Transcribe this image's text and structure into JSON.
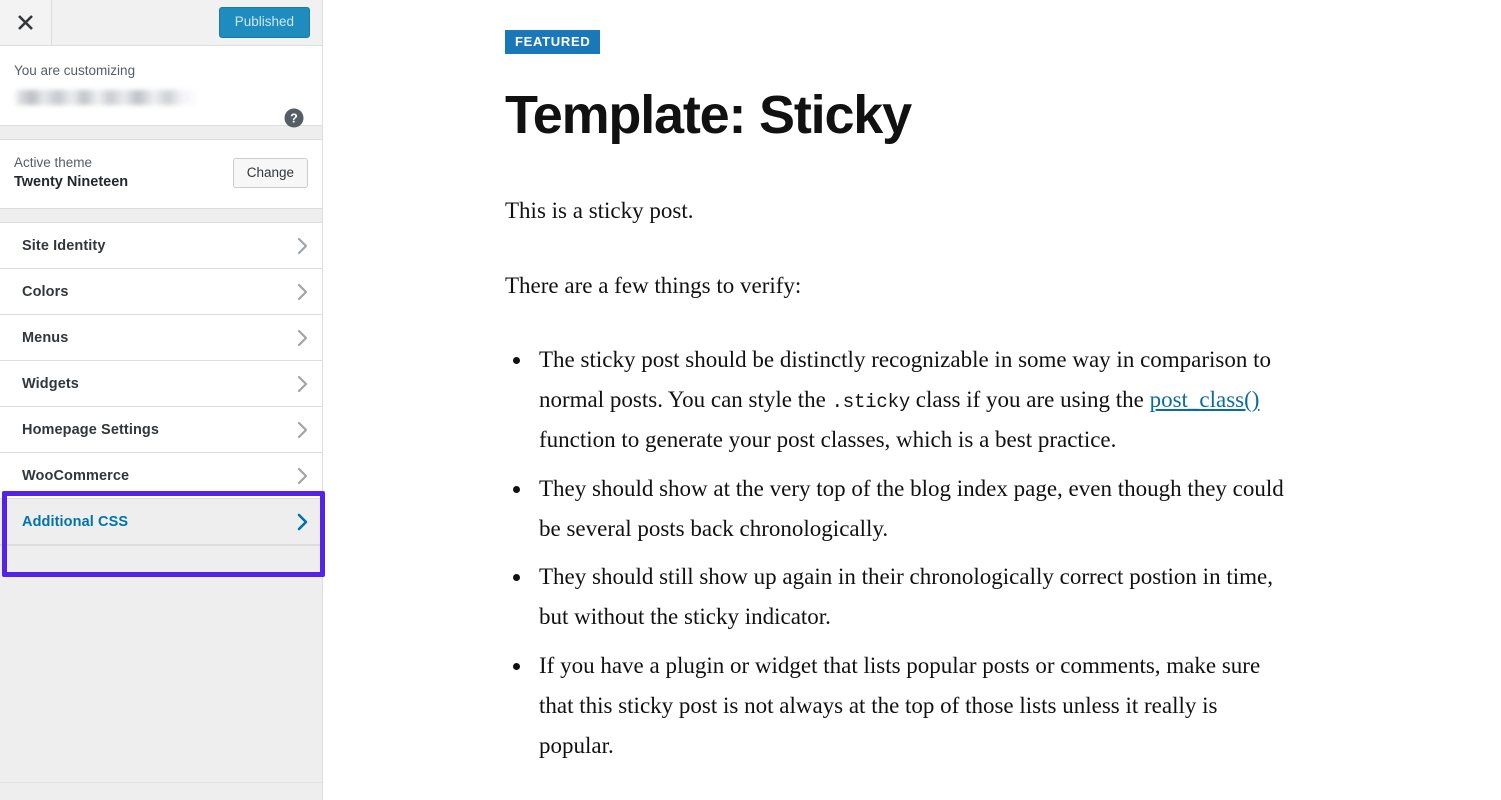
{
  "header": {
    "close_icon": "close-icon",
    "publish_label": "Published"
  },
  "customizing_panel": {
    "label": "You are customizing",
    "site_name": "",
    "help_icon": "help-circle-icon"
  },
  "active_theme": {
    "eyebrow": "Active theme",
    "name": "Twenty Nineteen",
    "change_label": "Change"
  },
  "nav": {
    "items": [
      {
        "label": "Site Identity",
        "chevron": "chevron-right-icon",
        "highlighted": false
      },
      {
        "label": "Colors",
        "chevron": "chevron-right-icon",
        "highlighted": false
      },
      {
        "label": "Menus",
        "chevron": "chevron-right-icon",
        "highlighted": false
      },
      {
        "label": "Widgets",
        "chevron": "chevron-right-icon",
        "highlighted": false
      },
      {
        "label": "Homepage Settings",
        "chevron": "chevron-right-icon",
        "highlighted": false
      },
      {
        "label": "WooCommerce",
        "chevron": "chevron-right-icon",
        "highlighted": false
      },
      {
        "label": "Additional CSS",
        "chevron": "chevron-right-icon",
        "highlighted": true
      }
    ]
  },
  "annotation": {
    "target": "Additional CSS",
    "color": "#5423e8"
  },
  "colors": {
    "accent_blue": "#0073aa",
    "publish_blue": "#1e8cbe",
    "badge_blue": "#1b78b8",
    "annotation_purple": "#5423e8",
    "sidebar_gray": "#eeeeee",
    "border_gray": "#dddddd"
  },
  "post": {
    "badge": "FEATURED",
    "title": "Template: Sticky",
    "intro": "This is a sticky post.",
    "lead_in": "There are a few things to verify:",
    "bullets": [
      {
        "parts": [
          {
            "type": "text",
            "value": "The sticky post should be distinctly recognizable in some way in comparison to normal posts. You can style the "
          },
          {
            "type": "code",
            "value": ".sticky"
          },
          {
            "type": "text",
            "value": " class if you are using the "
          },
          {
            "type": "link",
            "value": "post_class()"
          },
          {
            "type": "text",
            "value": " function to generate your post classes, which is a best practice."
          }
        ]
      },
      {
        "parts": [
          {
            "type": "text",
            "value": "They should show at the very top of the blog index page, even though they could be several posts back chronologically."
          }
        ]
      },
      {
        "parts": [
          {
            "type": "text",
            "value": "They should still show up again in their chronologically correct postion in time, but without the sticky indicator."
          }
        ]
      },
      {
        "parts": [
          {
            "type": "text",
            "value": "If you have a plugin or widget that lists popular posts or comments, make sure that this sticky post is not always at the top of those lists unless it really is popular."
          }
        ]
      }
    ]
  }
}
